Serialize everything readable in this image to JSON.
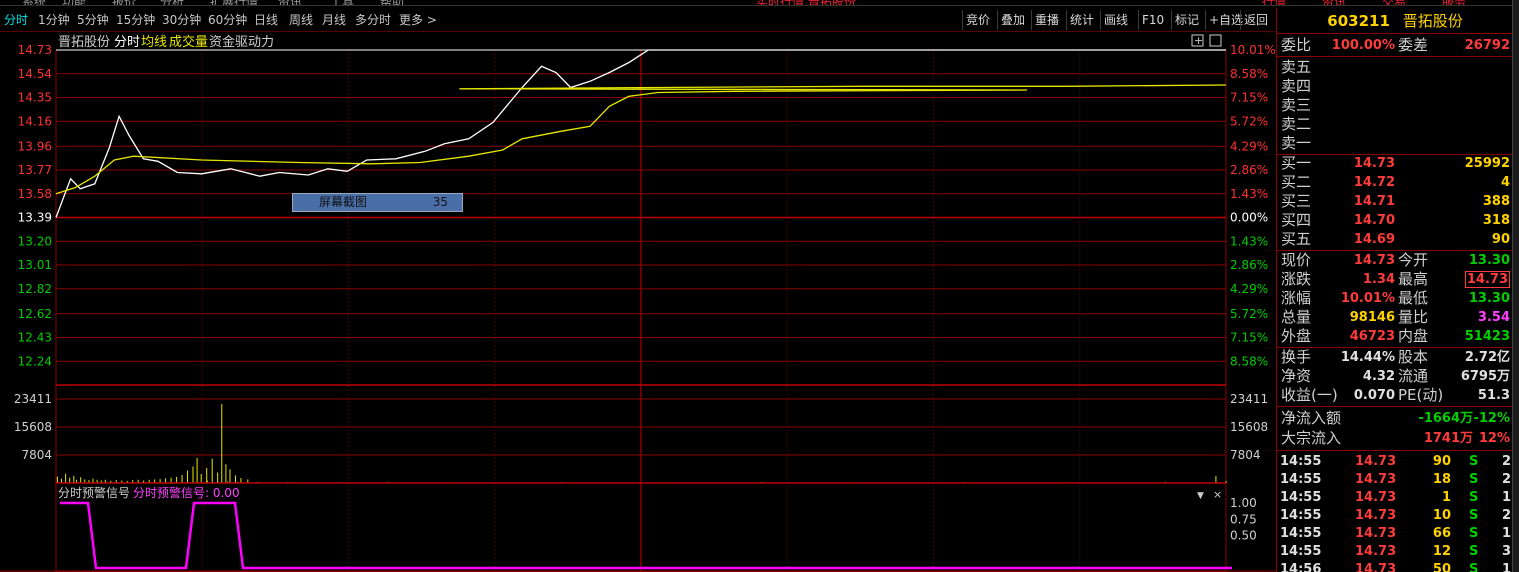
{
  "menu_strip": {
    "items": [
      "系统",
      "功能",
      "报价",
      "分析",
      "扩展行情",
      "资讯",
      "工具",
      "帮助"
    ],
    "center_title": "实时行情 晋拓股份",
    "right_buttons": [
      "行情",
      "资讯",
      "交易",
      "服务"
    ]
  },
  "toolbar": {
    "tabs": [
      "分时",
      "1分钟",
      "5分钟",
      "15分钟",
      "30分钟",
      "60分钟",
      "日线",
      "周线",
      "月线",
      "多分时",
      "更多 >"
    ],
    "active_tab": "分时",
    "buttons": [
      "竞价",
      "叠加",
      "重播",
      "统计",
      "画线",
      "F10",
      "标记",
      "+自选",
      "返回"
    ]
  },
  "chart_header": {
    "stock_name": "晋拓股份",
    "mode": "分时",
    "avg_label": "均线",
    "volume_label": "成交量",
    "fund_label": "资金驱动力"
  },
  "screenshot_tip": {
    "label": "屏幕截图",
    "number": "35"
  },
  "colors": {
    "up": "#ff3030",
    "down": "#00cc00",
    "price_line": "#ffffff",
    "avg_line": "#e6e600",
    "grid": "#8b0000",
    "signal": "#ff00ff",
    "title": "#ffd200"
  },
  "chart_data": [
    {
      "type": "line",
      "title": "分时",
      "price_ticks": [
        "14.73",
        "14.54",
        "14.35",
        "14.16",
        "13.96",
        "13.77",
        "13.58",
        "13.39",
        "13.20",
        "13.01",
        "12.82",
        "12.62",
        "12.43",
        "12.24"
      ],
      "pct_ticks": [
        "10.01%",
        "8.58%",
        "7.15%",
        "5.72%",
        "4.29%",
        "2.86%",
        "1.43%",
        "0.00%",
        "1.43%",
        "2.86%",
        "4.29%",
        "5.72%",
        "7.15%",
        "8.58%"
      ],
      "ylim": [
        12.05,
        14.73
      ],
      "prev_close": 13.39,
      "x_points": 241,
      "series": [
        {
          "name": "分时",
          "points": [
            [
              0,
              13.39
            ],
            [
              3,
              13.7
            ],
            [
              5,
              13.62
            ],
            [
              8,
              13.66
            ],
            [
              11,
              13.95
            ],
            [
              13,
              14.2
            ],
            [
              15,
              14.05
            ],
            [
              18,
              13.86
            ],
            [
              21,
              13.84
            ],
            [
              25,
              13.75
            ],
            [
              30,
              13.74
            ],
            [
              36,
              13.78
            ],
            [
              42,
              13.72
            ],
            [
              46,
              13.75
            ],
            [
              52,
              13.73
            ],
            [
              56,
              13.78
            ],
            [
              60,
              13.76
            ],
            [
              64,
              13.85
            ],
            [
              70,
              13.86
            ],
            [
              76,
              13.92
            ],
            [
              80,
              13.98
            ],
            [
              85,
              14.02
            ],
            [
              90,
              14.15
            ],
            [
              96,
              14.43
            ],
            [
              100,
              14.6
            ],
            [
              103,
              14.55
            ],
            [
              106,
              14.43
            ],
            [
              110,
              14.48
            ],
            [
              114,
              14.55
            ],
            [
              118,
              14.63
            ],
            [
              122,
              14.73
            ],
            [
              241,
              14.73
            ]
          ]
        },
        {
          "name": "均线",
          "points": [
            [
              0,
              13.58
            ],
            [
              4,
              13.63
            ],
            [
              8,
              13.72
            ],
            [
              12,
              13.85
            ],
            [
              16,
              13.88
            ],
            [
              30,
              13.85
            ],
            [
              50,
              13.83
            ],
            [
              65,
              13.82
            ],
            [
              75,
              13.83
            ],
            [
              85,
              13.88
            ],
            [
              92,
              13.93
            ],
            [
              96,
              14.02
            ],
            [
              104,
              14.08
            ],
            [
              110,
              14.12
            ],
            [
              114,
              14.28
            ],
            [
              118,
              14.36
            ],
            [
              124,
              14.39
            ],
            [
              140,
              14.4
            ],
            [
              200,
              14.41
            ],
            [
              400,
              14.42
            ],
            [
              600,
              14.43
            ],
            [
              800,
              14.44
            ],
            [
              1000,
              14.44
            ],
            [
              1160,
              14.45
            ]
          ]
        }
      ]
    },
    {
      "type": "bar",
      "title": "成交量",
      "yticks": [
        "23411",
        "15608",
        "7804"
      ],
      "ylim": [
        0,
        23411
      ]
    },
    {
      "type": "line",
      "title": "分时预警信号",
      "indicator_label": "分时预警信号: 0.00",
      "yticks": [
        "1.00",
        "0.75",
        "0.50"
      ],
      "ylim": [
        0,
        1
      ],
      "series": [
        {
          "name": "分时预警信号",
          "points": [
            [
              0,
              1
            ],
            [
              28,
              1
            ],
            [
              36,
              0
            ],
            [
              126,
              0
            ],
            [
              134,
              1
            ],
            [
              175,
              1
            ],
            [
              183,
              0
            ],
            [
              1172,
              0
            ]
          ]
        }
      ]
    }
  ],
  "right_panel": {
    "code": "603211",
    "name": "晋拓股份",
    "weibi": {
      "label": "委比",
      "value": "100.00%",
      "label2": "委差",
      "value2": "26792"
    },
    "sell": [
      {
        "label": "卖五"
      },
      {
        "label": "卖四"
      },
      {
        "label": "卖三"
      },
      {
        "label": "卖二"
      },
      {
        "label": "卖一"
      }
    ],
    "buy": [
      {
        "label": "买一",
        "price": "14.73",
        "vol": "25992"
      },
      {
        "label": "买二",
        "price": "14.72",
        "vol": "4"
      },
      {
        "label": "买三",
        "price": "14.71",
        "vol": "388"
      },
      {
        "label": "买四",
        "price": "14.70",
        "vol": "318"
      },
      {
        "label": "买五",
        "price": "14.69",
        "vol": "90"
      }
    ],
    "quote": [
      {
        "l1": "现价",
        "v1": "14.73",
        "c1": "up",
        "l2": "今开",
        "v2": "13.30",
        "c2": "down"
      },
      {
        "l1": "涨跌",
        "v1": "1.34",
        "c1": "up",
        "l2": "最高",
        "v2": "14.73",
        "c2": "up"
      },
      {
        "l1": "涨幅",
        "v1": "10.01%",
        "c1": "up",
        "l2": "最低",
        "v2": "13.30",
        "c2": "down"
      },
      {
        "l1": "总量",
        "v1": "98146",
        "c1": "yellow",
        "l2": "量比",
        "v2": "3.54",
        "c2": "magenta"
      },
      {
        "l1": "外盘",
        "v1": "46723",
        "c1": "up",
        "l2": "内盘",
        "v2": "51423",
        "c2": "down"
      }
    ],
    "fund": [
      {
        "l1": "换手",
        "v1": "14.44%",
        "l2": "股本",
        "v2": "2.72亿"
      },
      {
        "l1": "净资",
        "v1": "4.32",
        "l2": "流通",
        "v2": "6795万"
      },
      {
        "l1": "收益(一)",
        "v1": "0.070",
        "l2": "PE(动)",
        "v2": "51.3"
      }
    ],
    "flow": [
      {
        "label": "净流入额",
        "value": "-1664万",
        "pct": "-12%",
        "color": "down"
      },
      {
        "label": "大宗流入",
        "value": "1741万",
        "pct": "12%",
        "color": "up"
      }
    ],
    "ticks": [
      {
        "time": "14:55",
        "price": "14.73",
        "vol": "90",
        "side": "S",
        "n": "2"
      },
      {
        "time": "14:55",
        "price": "14.73",
        "vol": "18",
        "side": "S",
        "n": "2"
      },
      {
        "time": "14:55",
        "price": "14.73",
        "vol": "1",
        "side": "S",
        "n": "1"
      },
      {
        "time": "14:55",
        "price": "14.73",
        "vol": "10",
        "side": "S",
        "n": "2"
      },
      {
        "time": "14:55",
        "price": "14.73",
        "vol": "66",
        "side": "S",
        "n": "1"
      },
      {
        "time": "14:55",
        "price": "14.73",
        "vol": "12",
        "side": "S",
        "n": "3"
      },
      {
        "time": "14:56",
        "price": "14.73",
        "vol": "50",
        "side": "S",
        "n": "1"
      }
    ]
  }
}
